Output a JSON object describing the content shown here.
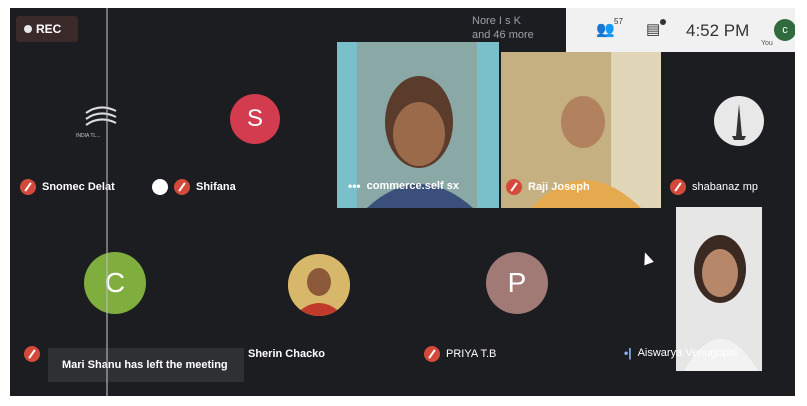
{
  "rec_label": "REC",
  "others": {
    "line1": "Nore I s K",
    "line2": "and 46 more"
  },
  "topbar": {
    "participants_count": "57",
    "time": "4:52 PM",
    "you_initial": "c",
    "you_label": "You"
  },
  "tiles": {
    "t1": {
      "name": "Snomec Delat",
      "logo_text": "INDIA TL..."
    },
    "t2": {
      "name": "Shifana",
      "initial": "S"
    },
    "t3": {
      "name": "commerce.self sx"
    },
    "t4": {
      "name": "Raji Joseph"
    },
    "t5": {
      "name": "shabanaz mp"
    },
    "t6": {
      "initial": "C"
    },
    "t7": {
      "name": "Sherin Chacko"
    },
    "t8": {
      "name": "PRIYA T.B",
      "initial": "P"
    },
    "t9": {
      "name": "Aiswarya Venugopal"
    }
  },
  "toast": "Mari Shanu has left the meeting",
  "colors": {
    "bg": "#1c1d20",
    "mute": "#d34a3b",
    "shifana": "#d23c4e",
    "c_avatar": "#7fae3f",
    "p_avatar": "#a17a75"
  }
}
